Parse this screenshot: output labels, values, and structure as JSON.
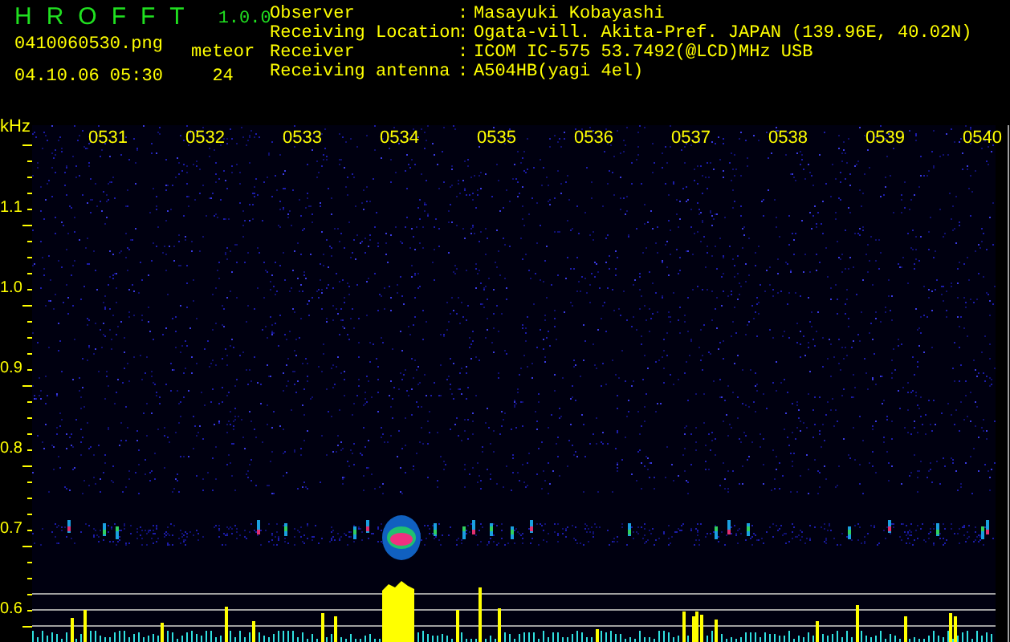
{
  "header": {
    "title": "HROFFT",
    "version": "1.0.0",
    "file": "0410060530.png",
    "datetime": "04.10.06 05:30",
    "meteor_label": "meteor",
    "meteor_count": "24"
  },
  "info": [
    {
      "label": "Observer",
      "separator": ":",
      "value": "Masayuki Kobayashi"
    },
    {
      "label": "Receiving Location",
      "separator": ":",
      "value": "Ogata-vill. Akita-Pref. JAPAN (139.96E, 40.02N)"
    },
    {
      "label": "Receiver",
      "separator": ":",
      "value": "ICOM IC-575 53.7492(@LCD)MHz USB"
    },
    {
      "label": "Receiving antenna",
      "separator": ":",
      "value": "A504HB(yagi 4el)"
    }
  ],
  "spectrogram": {
    "unit": "kHz",
    "frequency_labels": [
      "1.1",
      "1.0",
      "0.9",
      "0.8",
      "0.7",
      "0.6"
    ],
    "time_labels": [
      "0531",
      "0532",
      "0533",
      "0534",
      "0535",
      "0536",
      "0537",
      "0538",
      "0539",
      "0540"
    ]
  }
}
